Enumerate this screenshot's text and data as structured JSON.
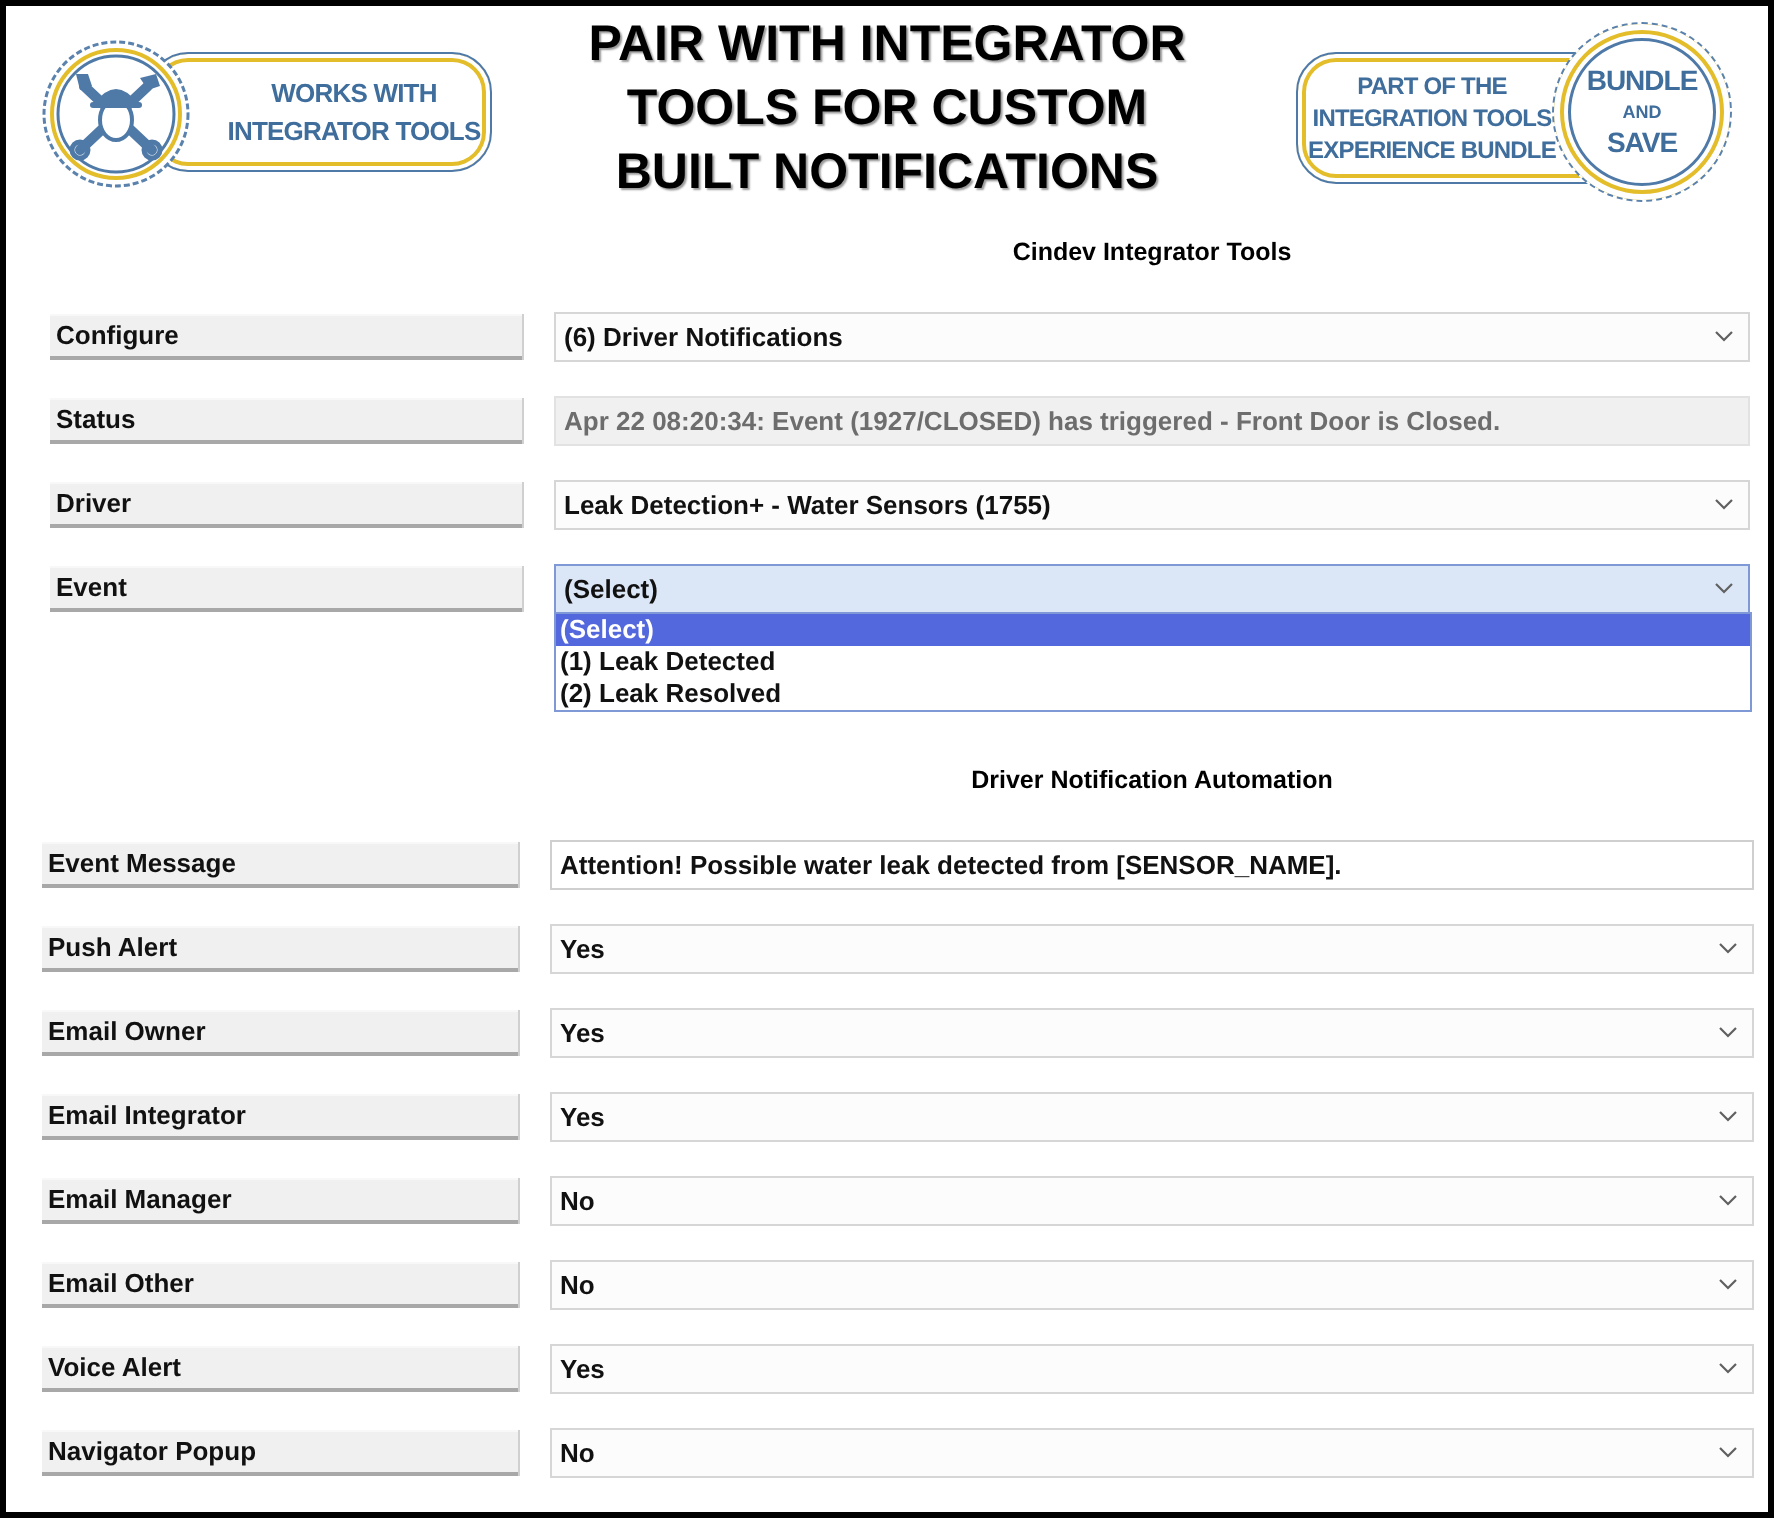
{
  "header": {
    "left_badge": {
      "lines": [
        "WORKS WITH",
        "INTEGRATOR TOOLS"
      ]
    },
    "title_lines": [
      "PAIR WITH INTEGRATOR",
      "TOOLS FOR CUSTOM",
      "BUILT NOTIFICATIONS"
    ],
    "right_badge": {
      "lines": [
        "PART OF THE",
        "INTEGRATION TOOLS",
        "EXPERIENCE BUNDLE"
      ],
      "seal": [
        "BUNDLE",
        "AND",
        "SAVE"
      ]
    }
  },
  "config": {
    "title": "Cindev Integrator Tools",
    "fields": [
      {
        "label": "Configure",
        "kind": "dropdown",
        "value": "(6) Driver Notifications",
        "expanded": false
      },
      {
        "label": "Status",
        "kind": "readonly",
        "value": "Apr 22 08:20:34: Event (1927/CLOSED) has triggered - Front Door is Closed."
      },
      {
        "label": "Driver",
        "kind": "dropdown",
        "value": "Leak Detection+ - Water Sensors (1755)",
        "expanded": false
      },
      {
        "label": "Event",
        "kind": "dropdown",
        "value": "(Select)",
        "expanded": true,
        "options": [
          {
            "label": "(Select)",
            "selected": true
          },
          {
            "label": "(1) Leak Detected",
            "selected": false
          },
          {
            "label": "(2) Leak Resolved",
            "selected": false
          }
        ]
      }
    ]
  },
  "automation": {
    "title": "Driver Notification Automation",
    "fields": [
      {
        "label": "Event Message",
        "kind": "text",
        "value": "Attention! Possible water leak detected from [SENSOR_NAME]."
      },
      {
        "label": "Push Alert",
        "kind": "dropdown",
        "value": "Yes",
        "expanded": false
      },
      {
        "label": "Email Owner",
        "kind": "dropdown",
        "value": "Yes",
        "expanded": false
      },
      {
        "label": "Email Integrator",
        "kind": "dropdown",
        "value": "Yes",
        "expanded": false
      },
      {
        "label": "Email Manager",
        "kind": "dropdown",
        "value": "No",
        "expanded": false
      },
      {
        "label": "Email Other",
        "kind": "dropdown",
        "value": "No",
        "expanded": false
      },
      {
        "label": "Voice Alert",
        "kind": "dropdown",
        "value": "Yes",
        "expanded": false
      },
      {
        "label": "Navigator Popup",
        "kind": "dropdown",
        "value": "No",
        "expanded": false
      }
    ]
  }
}
